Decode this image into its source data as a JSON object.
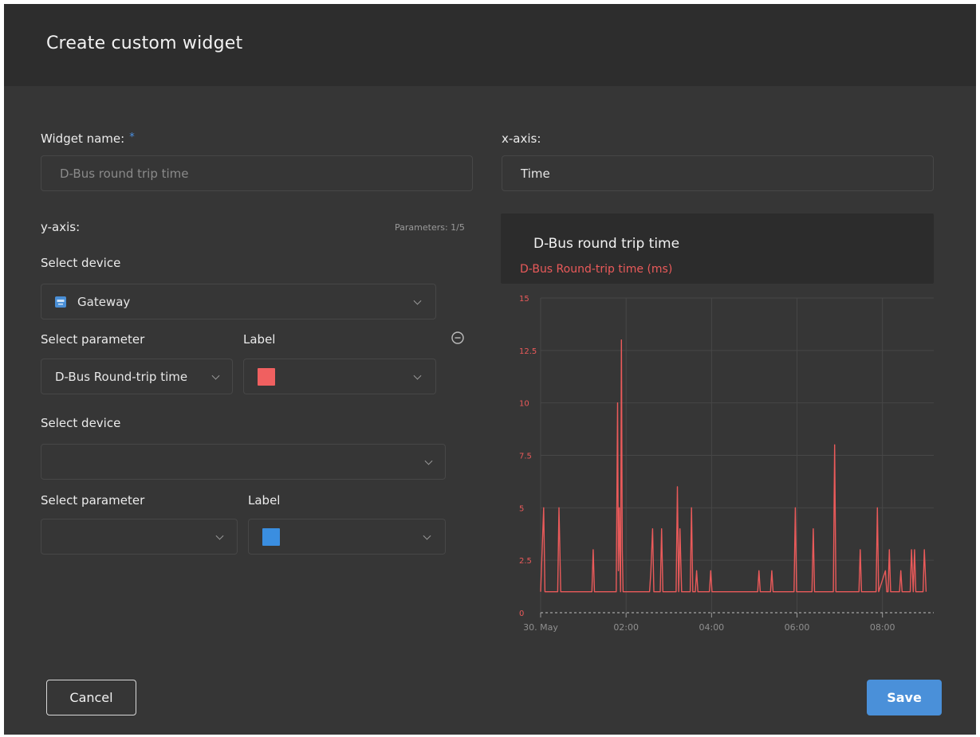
{
  "dialog": {
    "title": "Create custom widget",
    "cancel_label": "Cancel",
    "save_label": "Save"
  },
  "form": {
    "widget_name_label": "Widget name:",
    "widget_name_required": "*",
    "widget_name_placeholder": "D-Bus round trip time",
    "x_axis_label": "x-axis:",
    "x_axis_value": "Time",
    "y_axis_label": "y-axis:",
    "parameters_count": "Parameters: 1/5",
    "series": [
      {
        "device_label": "Select device",
        "device_value": "Gateway",
        "device_icon": "gateway-device-icon",
        "parameter_label": "Select parameter",
        "parameter_value": "D-Bus Round-trip time",
        "color_label": "Label",
        "color": "#f06060"
      },
      {
        "device_label": "Select device",
        "device_value": "",
        "parameter_label": "Select parameter",
        "parameter_value": "",
        "color_label": "Label",
        "color": "#3a8ee0"
      }
    ]
  },
  "chart_data": {
    "type": "line",
    "title": "D-Bus round trip time",
    "series": [
      {
        "name": "D-Bus Round-trip time (ms)",
        "color": "#ea5a5a",
        "x_hours": [
          0.0,
          0.07,
          0.1,
          0.13,
          0.4,
          0.43,
          0.47,
          1.2,
          1.23,
          1.26,
          1.77,
          1.8,
          1.82,
          1.84,
          1.87,
          1.89,
          1.91,
          1.93,
          1.96,
          2.0,
          2.55,
          2.58,
          2.62,
          2.65,
          2.8,
          2.83,
          2.86,
          3.17,
          3.2,
          3.23,
          3.26,
          3.3,
          3.33,
          3.5,
          3.53,
          3.56,
          3.62,
          3.65,
          3.68,
          3.95,
          3.98,
          4.01,
          5.08,
          5.11,
          5.14,
          5.38,
          5.41,
          5.44,
          5.93,
          5.96,
          5.99,
          6.35,
          6.38,
          6.41,
          6.85,
          6.88,
          6.91,
          7.45,
          7.48,
          7.51,
          7.85,
          7.88,
          7.91,
          8.07,
          8.1,
          8.13,
          8.16,
          8.19,
          8.4,
          8.43,
          8.46,
          8.65,
          8.68,
          8.72,
          8.75,
          8.78,
          8.95,
          8.98,
          9.02
        ],
        "y_values": [
          1,
          5,
          1,
          1,
          1,
          5,
          1,
          1,
          3,
          1,
          1,
          10,
          2,
          5,
          1,
          13,
          3,
          1,
          1,
          1,
          1,
          2,
          4,
          1,
          1,
          4,
          1,
          1,
          6,
          1,
          4,
          1,
          1,
          1,
          5,
          1,
          1,
          2,
          1,
          1,
          2,
          1,
          1,
          2,
          1,
          1,
          2,
          1,
          1,
          5,
          1,
          1,
          4,
          1,
          1,
          8,
          1,
          1,
          3,
          1,
          1,
          5,
          1,
          2,
          1,
          1,
          3,
          1,
          1,
          2,
          1,
          1,
          3,
          1,
          3,
          1,
          1,
          3,
          1
        ]
      }
    ],
    "yticks": [
      "0",
      "2.5",
      "5",
      "7.5",
      "10",
      "12.5",
      "15"
    ],
    "ylim": [
      0,
      15
    ],
    "xticks": [
      "30. May",
      "02:00",
      "04:00",
      "06:00",
      "08:00"
    ],
    "xtick_hours": [
      0,
      2,
      4,
      6,
      8
    ],
    "xlim_hours": [
      0,
      9.2
    ],
    "grid": true
  }
}
